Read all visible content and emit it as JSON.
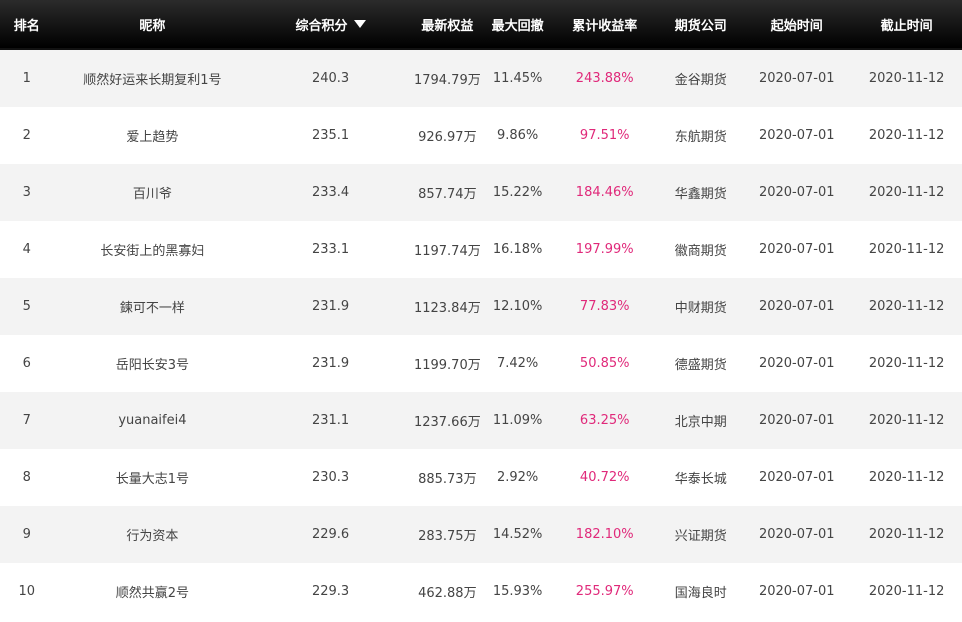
{
  "header": {
    "rank": "排名",
    "nickname": "昵称",
    "score": "综合积分",
    "equity": "最新权益",
    "drawdown": "最大回撤",
    "return": "累计收益率",
    "company": "期货公司",
    "start": "起始时间",
    "end": "截止时间"
  },
  "colors": {
    "header_bg": "#000000",
    "row_alt": "#f3f3f3",
    "return_color": "#e0297a"
  },
  "rows": [
    {
      "rank": "1",
      "nickname": "顺然好运来长期复利1号",
      "score": "240.3",
      "equity": "1794.79万",
      "drawdown": "11.45%",
      "return": "243.88%",
      "company": "金谷期货",
      "start": "2020-07-01",
      "end": "2020-11-12"
    },
    {
      "rank": "2",
      "nickname": "爱上趋势",
      "score": "235.1",
      "equity": "926.97万",
      "drawdown": "9.86%",
      "return": "97.51%",
      "company": "东航期货",
      "start": "2020-07-01",
      "end": "2020-11-12"
    },
    {
      "rank": "3",
      "nickname": "百川爷",
      "score": "233.4",
      "equity": "857.74万",
      "drawdown": "15.22%",
      "return": "184.46%",
      "company": "华鑫期货",
      "start": "2020-07-01",
      "end": "2020-11-12"
    },
    {
      "rank": "4",
      "nickname": "长安街上的黑寡妇",
      "score": "233.1",
      "equity": "1197.74万",
      "drawdown": "16.18%",
      "return": "197.99%",
      "company": "徽商期货",
      "start": "2020-07-01",
      "end": "2020-11-12"
    },
    {
      "rank": "5",
      "nickname": "鍊可不一样",
      "score": "231.9",
      "equity": "1123.84万",
      "drawdown": "12.10%",
      "return": "77.83%",
      "company": "中财期货",
      "start": "2020-07-01",
      "end": "2020-11-12"
    },
    {
      "rank": "6",
      "nickname": "岳阳长安3号",
      "score": "231.9",
      "equity": "1199.70万",
      "drawdown": "7.42%",
      "return": "50.85%",
      "company": "德盛期货",
      "start": "2020-07-01",
      "end": "2020-11-12"
    },
    {
      "rank": "7",
      "nickname": "yuanaifei4",
      "score": "231.1",
      "equity": "1237.66万",
      "drawdown": "11.09%",
      "return": "63.25%",
      "company": "北京中期",
      "start": "2020-07-01",
      "end": "2020-11-12"
    },
    {
      "rank": "8",
      "nickname": "长量大志1号",
      "score": "230.3",
      "equity": "885.73万",
      "drawdown": "2.92%",
      "return": "40.72%",
      "company": "华泰长城",
      "start": "2020-07-01",
      "end": "2020-11-12"
    },
    {
      "rank": "9",
      "nickname": "行为资本",
      "score": "229.6",
      "equity": "283.75万",
      "drawdown": "14.52%",
      "return": "182.10%",
      "company": "兴证期货",
      "start": "2020-07-01",
      "end": "2020-11-12"
    },
    {
      "rank": "10",
      "nickname": "顺然共赢2号",
      "score": "229.3",
      "equity": "462.88万",
      "drawdown": "15.93%",
      "return": "255.97%",
      "company": "国海良时",
      "start": "2020-07-01",
      "end": "2020-11-12"
    }
  ]
}
